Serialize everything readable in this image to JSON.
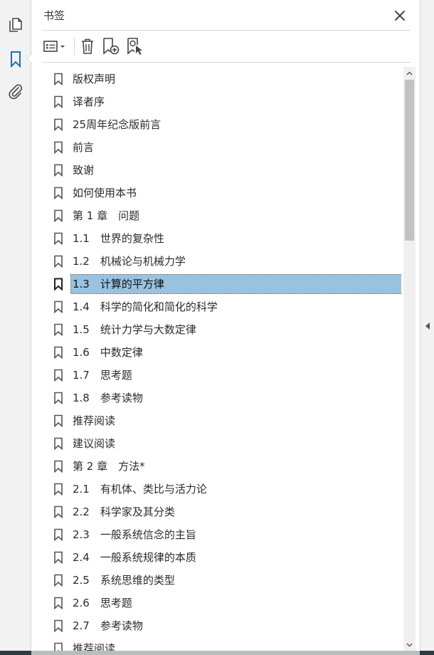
{
  "panel": {
    "title": "书签",
    "close_icon": "close-icon"
  },
  "left_rail": {
    "items": [
      {
        "name": "page-thumbnails",
        "icon": "pages-icon"
      },
      {
        "name": "bookmarks",
        "icon": "bookmark-icon",
        "active": true
      },
      {
        "name": "attachments",
        "icon": "paperclip-icon"
      }
    ]
  },
  "toolbar": {
    "buttons": [
      {
        "name": "options-menu",
        "icon": "list-options-icon"
      },
      {
        "name": "delete-bookmark",
        "icon": "trash-icon"
      },
      {
        "name": "new-bookmark",
        "icon": "bookmark-add-icon"
      },
      {
        "name": "find-current-bookmark",
        "icon": "bookmark-find-icon"
      }
    ]
  },
  "bookmarks": [
    {
      "label": "版权声明"
    },
    {
      "label": "译者序"
    },
    {
      "label": "25周年纪念版前言"
    },
    {
      "label": "前言"
    },
    {
      "label": "致谢"
    },
    {
      "label": "如何使用本书"
    },
    {
      "label": "第 1 章　问题"
    },
    {
      "label": "1.1　世界的复杂性"
    },
    {
      "label": "1.2　机械论与机械力学"
    },
    {
      "label": "1.3　计算的平方律",
      "selected": true
    },
    {
      "label": "1.4　科学的简化和简化的科学"
    },
    {
      "label": "1.5　统计力学与大数定律"
    },
    {
      "label": "1.6　中数定律"
    },
    {
      "label": "1.7　思考题"
    },
    {
      "label": "1.8　参考读物"
    },
    {
      "label": "推荐阅读"
    },
    {
      "label": "建议阅读"
    },
    {
      "label": "第 2 章　方法*"
    },
    {
      "label": "2.1　有机体、类比与活力论"
    },
    {
      "label": "2.2　科学家及其分类"
    },
    {
      "label": "2.3　一般系统信念的主旨"
    },
    {
      "label": "2.4　一般系统规律的本质"
    },
    {
      "label": "2.5　系统思维的类型"
    },
    {
      "label": "2.6　思考题"
    },
    {
      "label": "2.7　参考读物"
    },
    {
      "label": "推荐阅读"
    }
  ],
  "colors": {
    "selection": "#99c2e0",
    "active_icon": "#1e6fb5",
    "icon": "#4a4a4a"
  }
}
